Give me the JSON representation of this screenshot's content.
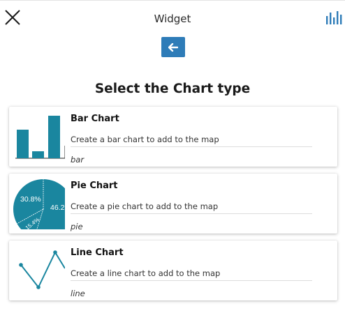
{
  "header": {
    "title": "Widget",
    "close_icon": "close-icon",
    "chart_menu_icon": "bar-chart-icon"
  },
  "back_button": {
    "icon": "arrow-left-icon",
    "color": "#2e7cb8"
  },
  "heading": "Select the Chart type",
  "accent_color": "#1a869f",
  "chart_types": [
    {
      "name": "Bar Chart",
      "description": "Create a bar chart to add to the map",
      "type": "bar"
    },
    {
      "name": "Pie Chart",
      "description": "Create a pie chart to add to the map",
      "type": "pie",
      "thumbnail_labels": [
        "30.8%",
        "46.2",
        "15.4%"
      ]
    },
    {
      "name": "Line Chart",
      "description": "Create a line chart to add to the map",
      "type": "line"
    }
  ]
}
